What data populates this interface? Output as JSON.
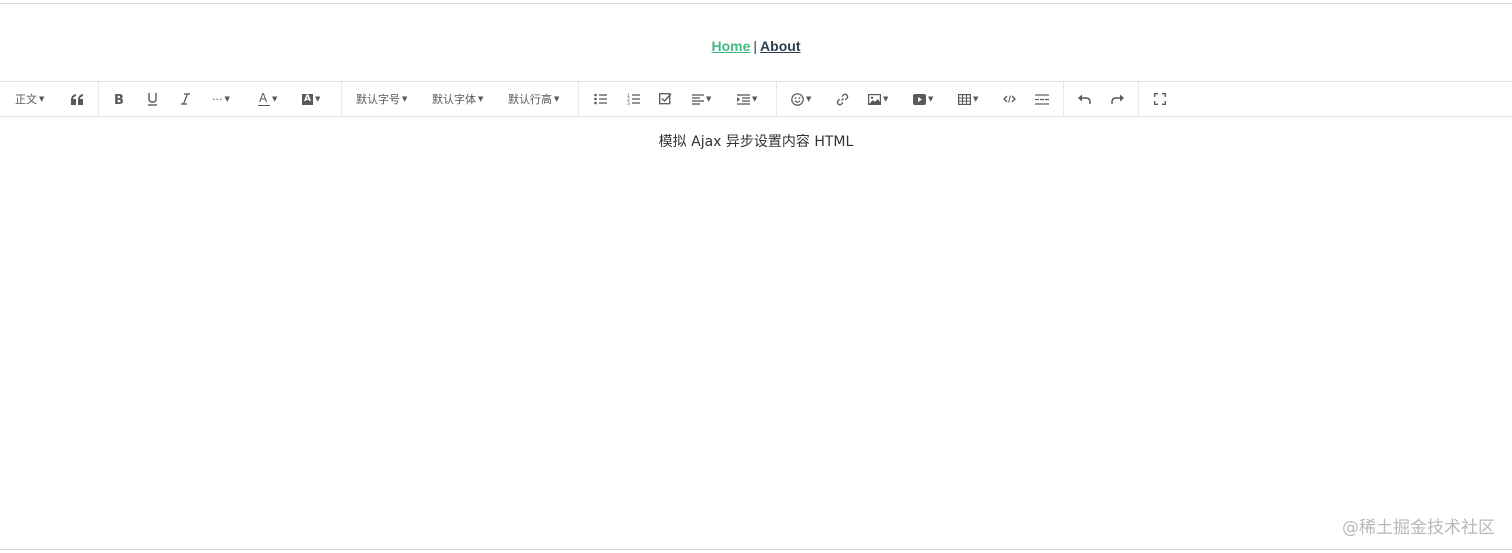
{
  "nav": {
    "home_label": "Home",
    "separator": "|",
    "about_label": "About",
    "home_color": "#42b983"
  },
  "toolbar": {
    "heading_label": "正文",
    "font_size_label": "默认字号",
    "font_family_label": "默认字体",
    "line_height_label": "默认行高",
    "more_label": "···",
    "font_color_label": "A",
    "bg_color_label": "A",
    "icons": [
      "quote-icon",
      "bold-icon",
      "underline-icon",
      "italic-icon",
      "more-icon",
      "font-color-icon",
      "bg-color-icon",
      "bulleted-list-icon",
      "numbered-list-icon",
      "todo-icon",
      "align-icon",
      "indent-icon",
      "emoji-icon",
      "link-icon",
      "image-icon",
      "video-icon",
      "table-icon",
      "code-icon",
      "divider-icon",
      "undo-icon",
      "redo-icon",
      "fullscreen-icon"
    ]
  },
  "editor": {
    "content": "模拟 Ajax 异步设置内容 HTML"
  },
  "watermark": "@稀土掘金技术社区"
}
